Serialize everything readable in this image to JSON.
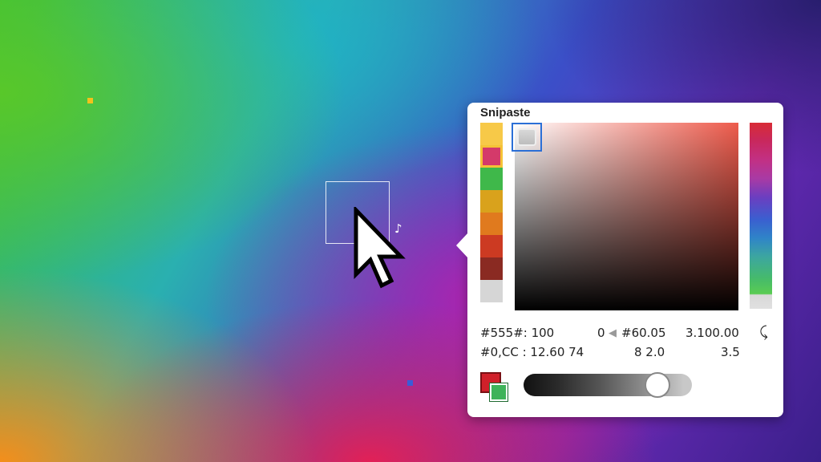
{
  "app": {
    "title": "Snipaste"
  },
  "swatches": [
    {
      "name": "swatch-yellow",
      "color": "#f7c948"
    },
    {
      "name": "swatch-magenta",
      "color": "#d43a6a",
      "selected": true
    },
    {
      "name": "swatch-green",
      "color": "#3fb84a"
    },
    {
      "name": "swatch-gold",
      "color": "#d9a21c"
    },
    {
      "name": "swatch-orange",
      "color": "#e07a1e"
    },
    {
      "name": "swatch-red",
      "color": "#cc3a22"
    },
    {
      "name": "swatch-maroon",
      "color": "#8a2a22"
    },
    {
      "name": "swatch-lightgray",
      "color": "#d6d6d6"
    }
  ],
  "readout": {
    "row1": {
      "a": "#555#: 100",
      "b": "0",
      "c": "#60.05",
      "d": "3.100.00"
    },
    "row2": {
      "a": "#0,CC : 12.60 74",
      "b": "8 2.0",
      "c": "3.5"
    }
  },
  "colors": {
    "primary_red": "#d0202a",
    "secondary_green": "#3fb35a",
    "selection_outline": "#2b6fd6"
  },
  "alpha": {
    "level": 0.85
  }
}
